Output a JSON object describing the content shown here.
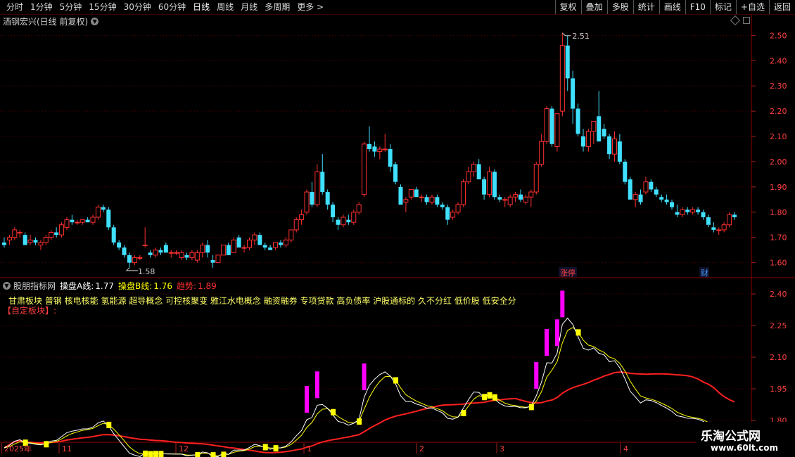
{
  "toolbar": {
    "periods": [
      "分时",
      "1分钟",
      "5分钟",
      "15分钟",
      "30分钟",
      "60分钟",
      "日线",
      "周线",
      "月线",
      "多周期",
      "更多 >"
    ],
    "active_period": "日线",
    "buttons": [
      "复权",
      "叠加",
      "多股",
      "统计",
      "画线",
      "F10",
      "标记",
      "+自选",
      "返回"
    ]
  },
  "main_chart": {
    "title": "酒钢宏兴(日线 前复权)",
    "high_label": "2.51",
    "low_label": "1.58",
    "price_ticks": [
      "2.50",
      "2.40",
      "2.30",
      "2.20",
      "2.10",
      "2.00",
      "1.90",
      "1.80",
      "1.70",
      "1.60"
    ],
    "markers": [
      {
        "text": "涨停",
        "color": "#ff4040"
      },
      {
        "text": "财",
        "color": "#40a0ff"
      }
    ]
  },
  "indicator": {
    "name": "股朋指标网",
    "line_a_label": "操盘A线:",
    "line_a_value": "1.77",
    "line_b_label": "操盘B线:",
    "line_b_value": "1.76",
    "trend_label": "趋势:",
    "trend_value": "1.89",
    "concepts": "甘肃板块 普钢 核电核能 氢能源 超导概念 可控核聚变 雅江水电概念 融资融券 专项贷款 高负债率 沪股通标的 久不分红 低价股 低安全分",
    "custom_block": "【自定板块】:",
    "ticks": [
      "2.40",
      "2.25",
      "2.10",
      "1.95",
      "1.80"
    ]
  },
  "time_axis": {
    "labels": [
      "2025年",
      "11",
      "12",
      "1",
      "2",
      "3",
      "4"
    ]
  },
  "watermark": {
    "title": "乐淘公式网",
    "url": "www.60lt.com"
  },
  "colors": {
    "up": "#ff3030",
    "down": "#40e0ff",
    "grid": "#5a0000",
    "line_a": "#ffffff",
    "line_b": "#ffff00",
    "trend": "#ff2020",
    "signal": "#ff00ff"
  },
  "chart_data": {
    "type": "candlestick",
    "ohlc": [
      [
        1.68,
        1.7,
        1.66,
        1.67
      ],
      [
        1.69,
        1.71,
        1.67,
        1.7
      ],
      [
        1.7,
        1.74,
        1.69,
        1.73
      ],
      [
        1.72,
        1.73,
        1.7,
        1.72
      ],
      [
        1.71,
        1.72,
        1.67,
        1.67
      ],
      [
        1.68,
        1.71,
        1.67,
        1.69
      ],
      [
        1.69,
        1.7,
        1.67,
        1.68
      ],
      [
        1.67,
        1.69,
        1.65,
        1.68
      ],
      [
        1.68,
        1.71,
        1.67,
        1.7
      ],
      [
        1.7,
        1.73,
        1.69,
        1.72
      ],
      [
        1.72,
        1.74,
        1.7,
        1.71
      ],
      [
        1.71,
        1.76,
        1.7,
        1.75
      ],
      [
        1.74,
        1.78,
        1.73,
        1.77
      ],
      [
        1.77,
        1.79,
        1.75,
        1.76
      ],
      [
        1.76,
        1.77,
        1.75,
        1.76
      ],
      [
        1.76,
        1.77,
        1.75,
        1.77
      ],
      [
        1.77,
        1.78,
        1.76,
        1.76
      ],
      [
        1.76,
        1.79,
        1.75,
        1.78
      ],
      [
        1.78,
        1.83,
        1.77,
        1.82
      ],
      [
        1.82,
        1.83,
        1.8,
        1.81
      ],
      [
        1.81,
        1.82,
        1.73,
        1.74
      ],
      [
        1.74,
        1.75,
        1.67,
        1.68
      ],
      [
        1.68,
        1.69,
        1.65,
        1.66
      ],
      [
        1.66,
        1.67,
        1.62,
        1.63
      ],
      [
        1.63,
        1.64,
        1.58,
        1.6
      ],
      [
        1.6,
        1.63,
        1.59,
        1.62
      ],
      [
        1.62,
        1.63,
        1.61,
        1.62
      ],
      [
        1.67,
        1.74,
        1.66,
        1.67
      ],
      [
        1.64,
        1.65,
        1.62,
        1.63
      ],
      [
        1.63,
        1.66,
        1.62,
        1.65
      ],
      [
        1.65,
        1.66,
        1.63,
        1.64
      ],
      [
        1.67,
        1.68,
        1.64,
        1.64
      ],
      [
        1.64,
        1.65,
        1.62,
        1.64
      ],
      [
        1.64,
        1.65,
        1.63,
        1.64
      ],
      [
        1.62,
        1.65,
        1.61,
        1.64
      ],
      [
        1.63,
        1.64,
        1.61,
        1.62
      ],
      [
        1.62,
        1.65,
        1.61,
        1.64
      ],
      [
        1.61,
        1.65,
        1.6,
        1.64
      ],
      [
        1.64,
        1.68,
        1.62,
        1.67
      ],
      [
        1.67,
        1.69,
        1.62,
        1.64
      ],
      [
        1.61,
        1.63,
        1.58,
        1.6
      ],
      [
        1.6,
        1.63,
        1.6,
        1.63
      ],
      [
        1.63,
        1.67,
        1.63,
        1.67
      ],
      [
        1.67,
        1.68,
        1.63,
        1.63
      ],
      [
        1.64,
        1.7,
        1.64,
        1.69
      ],
      [
        1.7,
        1.71,
        1.66,
        1.66
      ],
      [
        1.66,
        1.67,
        1.64,
        1.66
      ],
      [
        1.66,
        1.7,
        1.65,
        1.69
      ],
      [
        1.69,
        1.72,
        1.67,
        1.71
      ],
      [
        1.71,
        1.72,
        1.67,
        1.67
      ],
      [
        1.67,
        1.68,
        1.65,
        1.66
      ],
      [
        1.66,
        1.67,
        1.65,
        1.65
      ],
      [
        1.66,
        1.68,
        1.65,
        1.68
      ],
      [
        1.68,
        1.69,
        1.66,
        1.67
      ],
      [
        1.67,
        1.7,
        1.66,
        1.69
      ],
      [
        1.69,
        1.73,
        1.68,
        1.73
      ],
      [
        1.73,
        1.78,
        1.72,
        1.77
      ],
      [
        1.77,
        1.81,
        1.75,
        1.79
      ],
      [
        1.8,
        1.89,
        1.79,
        1.88
      ],
      [
        1.88,
        1.92,
        1.82,
        1.83
      ],
      [
        1.83,
        1.99,
        1.82,
        1.96
      ],
      [
        1.96,
        2.03,
        1.87,
        1.88
      ],
      [
        1.88,
        1.89,
        1.81,
        1.83
      ],
      [
        1.83,
        1.84,
        1.76,
        1.78
      ],
      [
        1.77,
        1.78,
        1.73,
        1.75
      ],
      [
        1.75,
        1.79,
        1.74,
        1.78
      ],
      [
        1.77,
        1.79,
        1.75,
        1.76
      ],
      [
        1.76,
        1.81,
        1.75,
        1.8
      ],
      [
        1.8,
        1.84,
        1.79,
        1.83
      ],
      [
        1.87,
        2.08,
        1.86,
        2.07
      ],
      [
        2.07,
        2.14,
        2.04,
        2.05
      ],
      [
        2.06,
        2.08,
        2.02,
        2.04
      ],
      [
        2.04,
        2.06,
        2.01,
        2.05
      ],
      [
        2.05,
        2.11,
        2.04,
        2.05
      ],
      [
        2.05,
        2.07,
        1.96,
        1.98
      ],
      [
        1.99,
        2.0,
        1.91,
        1.92
      ],
      [
        1.9,
        1.91,
        1.83,
        1.83
      ],
      [
        1.84,
        1.86,
        1.8,
        1.85
      ],
      [
        1.86,
        1.89,
        1.85,
        1.89
      ],
      [
        1.89,
        1.9,
        1.86,
        1.86
      ],
      [
        1.86,
        1.87,
        1.84,
        1.86
      ],
      [
        1.86,
        1.87,
        1.83,
        1.84
      ],
      [
        1.84,
        1.87,
        1.83,
        1.86
      ],
      [
        1.86,
        1.87,
        1.82,
        1.83
      ],
      [
        1.83,
        1.84,
        1.81,
        1.82
      ],
      [
        1.82,
        1.83,
        1.75,
        1.77
      ],
      [
        1.78,
        1.81,
        1.77,
        1.8
      ],
      [
        1.8,
        1.84,
        1.79,
        1.83
      ],
      [
        1.83,
        1.93,
        1.82,
        1.92
      ],
      [
        1.92,
        1.98,
        1.91,
        1.96
      ],
      [
        1.96,
        2.0,
        1.94,
        1.99
      ],
      [
        1.99,
        2.01,
        1.93,
        1.93
      ],
      [
        1.93,
        1.94,
        1.85,
        1.87
      ],
      [
        1.87,
        1.98,
        1.86,
        1.96
      ],
      [
        1.96,
        1.97,
        1.85,
        1.86
      ],
      [
        1.86,
        1.87,
        1.84,
        1.85
      ],
      [
        1.85,
        1.86,
        1.82,
        1.85
      ],
      [
        1.83,
        1.87,
        1.82,
        1.86
      ],
      [
        1.86,
        1.88,
        1.84,
        1.87
      ],
      [
        1.87,
        1.89,
        1.84,
        1.85
      ],
      [
        1.84,
        1.87,
        1.83,
        1.86
      ],
      [
        1.86,
        1.89,
        1.82,
        1.88
      ],
      [
        1.88,
        2.0,
        1.87,
        1.99
      ],
      [
        1.99,
        2.11,
        1.98,
        2.08
      ],
      [
        2.08,
        2.22,
        2.07,
        2.21
      ],
      [
        2.21,
        2.22,
        2.06,
        2.07
      ],
      [
        2.06,
        2.19,
        2.04,
        2.19
      ],
      [
        2.2,
        2.51,
        2.18,
        2.46
      ],
      [
        2.46,
        2.5,
        2.28,
        2.33
      ],
      [
        2.33,
        2.36,
        2.15,
        2.21
      ],
      [
        2.21,
        2.23,
        2.1,
        2.11
      ],
      [
        2.1,
        2.13,
        2.04,
        2.06
      ],
      [
        2.06,
        2.13,
        2.04,
        2.12
      ],
      [
        2.12,
        2.16,
        2.07,
        2.16
      ],
      [
        2.18,
        2.28,
        2.08,
        2.08
      ],
      [
        2.13,
        2.15,
        2.09,
        2.1
      ],
      [
        2.1,
        2.11,
        2.01,
        2.03
      ],
      [
        2.03,
        2.12,
        2.0,
        2.09
      ],
      [
        2.08,
        2.11,
        1.99,
        2.0
      ],
      [
        2.0,
        2.01,
        1.91,
        1.92
      ],
      [
        1.93,
        1.94,
        1.85,
        1.85
      ],
      [
        1.85,
        1.88,
        1.82,
        1.87
      ],
      [
        1.87,
        1.89,
        1.83,
        1.84
      ],
      [
        1.88,
        1.94,
        1.87,
        1.92
      ],
      [
        1.92,
        1.93,
        1.88,
        1.89
      ],
      [
        1.89,
        1.9,
        1.86,
        1.87
      ],
      [
        1.86,
        1.87,
        1.84,
        1.85
      ],
      [
        1.85,
        1.87,
        1.83,
        1.84
      ],
      [
        1.84,
        1.85,
        1.81,
        1.82
      ],
      [
        1.8,
        1.83,
        1.78,
        1.79
      ],
      [
        1.79,
        1.82,
        1.78,
        1.81
      ],
      [
        1.81,
        1.82,
        1.79,
        1.8
      ],
      [
        1.8,
        1.82,
        1.79,
        1.81
      ],
      [
        1.81,
        1.82,
        1.79,
        1.8
      ],
      [
        1.8,
        1.81,
        1.77,
        1.78
      ],
      [
        1.78,
        1.79,
        1.74,
        1.75
      ],
      [
        1.74,
        1.76,
        1.72,
        1.73
      ],
      [
        1.73,
        1.74,
        1.71,
        1.73
      ],
      [
        1.73,
        1.76,
        1.72,
        1.75
      ],
      [
        1.75,
        1.8,
        1.74,
        1.79
      ],
      [
        1.79,
        1.8,
        1.77,
        1.78
      ]
    ],
    "indicator_range": [
      1.7,
      2.46
    ]
  }
}
